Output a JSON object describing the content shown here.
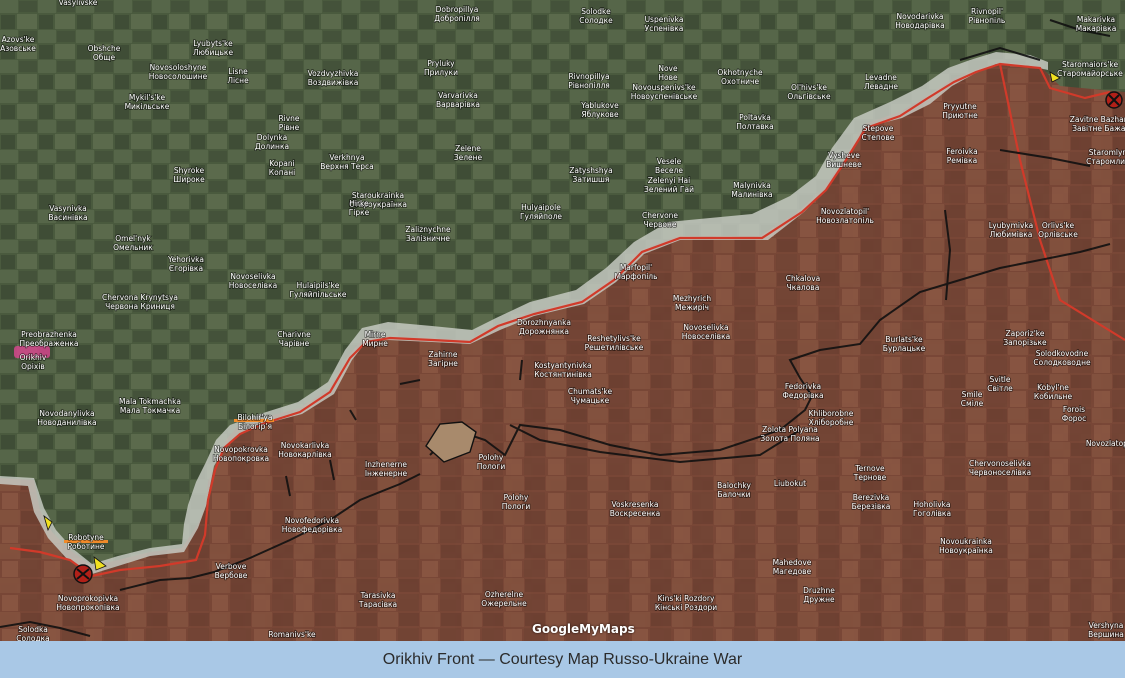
{
  "caption": "Orikhiv Front — Courtesy Map Russo-Ukraine War",
  "attribution": "GoogleMyMaps",
  "colors": {
    "ukrainian_controlled_terrain": "#4b5a3f",
    "russian_controlled_overlay": "#8a4a3a",
    "contested_gray_zone": "#c9cdc6",
    "front_line_red": "#d13a2a",
    "fortification_lines": "#111111",
    "caption_background": "#a9c8e6",
    "highlight_pink": "#d4468c",
    "marker_yellow": "#f0e020"
  },
  "icons": [
    "map-pin-icon",
    "explosion-marker-icon"
  ],
  "places": [
    [
      "Dobropillya",
      "Добропілля",
      457,
      12
    ],
    [
      "Solodke",
      "Солодке",
      596,
      14
    ],
    [
      "Uspenivka",
      "Успенівка",
      664,
      22
    ],
    [
      "Novodarivka",
      "Новодарівка",
      920,
      19
    ],
    [
      "Rivnopil'",
      "Рівнопіль",
      987,
      14
    ],
    [
      "Makarivka",
      "Макарівка",
      1096,
      22
    ],
    [
      "Vasylivske",
      "",
      78,
      5
    ],
    [
      "Obshche",
      "Обще",
      104,
      51
    ],
    [
      "Lyubyts'ke",
      "Любицьке",
      213,
      46
    ],
    [
      "Novosoloshyne",
      "Новосолошине",
      178,
      70
    ],
    [
      "Lisne",
      "Лісне",
      238,
      74
    ],
    [
      "Vozdvyzhivka",
      "Воздвижівка",
      333,
      76
    ],
    [
      "Pryluky",
      "Прилуки",
      441,
      66
    ],
    [
      "Nove",
      "Нове",
      668,
      71
    ],
    [
      "Okhotnyche",
      "Охотниче",
      740,
      75
    ],
    [
      "Rivnopillya",
      "Рівнопілля",
      589,
      79
    ],
    [
      "Novouspenivs'ke",
      "Новоуспенівське",
      664,
      90
    ],
    [
      "Ol'hivs'ke",
      "Ольгівське",
      809,
      90
    ],
    [
      "Levadne",
      "Левадне",
      881,
      80
    ],
    [
      "Staromaiors'ke",
      "Старомайорське",
      1090,
      67
    ],
    [
      "Mykil's'ke",
      "Микільське",
      147,
      100
    ],
    [
      "Varvarivka",
      "Варварівка",
      458,
      98
    ],
    [
      "Yablukove",
      "Яблукове",
      600,
      108
    ],
    [
      "Poltavka",
      "Полтавка",
      755,
      120
    ],
    [
      "Pryyutne",
      "Приютне",
      960,
      109
    ],
    [
      "Rivne",
      "Рівне",
      289,
      121
    ],
    [
      "Stepove",
      "Степове",
      878,
      131
    ],
    [
      "Dolynka",
      "Долинка",
      272,
      140
    ],
    [
      "Zelene",
      "Зелене",
      468,
      151
    ],
    [
      "Verkhnya",
      "Верхня Терса",
      347,
      160
    ],
    [
      "Kopani",
      "Копані",
      282,
      166
    ],
    [
      "Shyroke",
      "Широке",
      189,
      173
    ],
    [
      "Vysheve",
      "Вишневе",
      844,
      158
    ],
    [
      "Zatyshshya",
      "Затишшя",
      591,
      173
    ],
    [
      "Vesele",
      "Веселе",
      669,
      164
    ],
    [
      "Zelenyi Hai",
      "Зелений Гай",
      669,
      183
    ],
    [
      "Malynivka",
      "Малинівка",
      752,
      188
    ],
    [
      "Feroivka",
      "Ремівка",
      962,
      154
    ],
    [
      "Staroukrainka",
      "Староукраїнка",
      378,
      198
    ],
    [
      "Hirke",
      "Гірке",
      359,
      206
    ],
    [
      "Hulyaipole",
      "Гуляйполе",
      541,
      210
    ],
    [
      "Vasynivka",
      "Васинівка",
      68,
      211
    ],
    [
      "Novozlatopil'",
      "Новозлатопіль",
      845,
      214
    ],
    [
      "Chervone",
      "Червоне",
      660,
      218
    ],
    [
      "Lyubymivka",
      "Любимівка",
      1011,
      228
    ],
    [
      "Orlivs'ke",
      "Орлівське",
      1058,
      228
    ],
    [
      "Zaliznychne",
      "Залізничне",
      428,
      232
    ],
    [
      "Omel'nyk",
      "Омельник",
      133,
      241
    ],
    [
      "Yehorivka",
      "Єгорівка",
      186,
      262
    ],
    [
      "Marfopil'",
      "Марфопіль",
      636,
      270
    ],
    [
      "Novoselivka",
      "Новоселівка",
      253,
      279
    ],
    [
      "Chkalova",
      "Чкалова",
      803,
      281
    ],
    [
      "Hulaipils'ke",
      "Гуляйпільське",
      318,
      288
    ],
    [
      "Chervona Krynytsya",
      "Червона Криниця",
      140,
      300
    ],
    [
      "Mezhyrich",
      "Межиріч",
      692,
      301
    ],
    [
      "Dorozhnyanka",
      "Дорожнянка",
      544,
      325
    ],
    [
      "Novoselivka",
      "Новоселівка",
      706,
      330
    ],
    [
      "Preobrazhenka",
      "Преображенка",
      49,
      337
    ],
    [
      "Charivne",
      "Чарівне",
      294,
      337
    ],
    [
      "Reshetylivs'ke",
      "Решетилівське",
      614,
      341
    ],
    [
      "Mirne",
      "Мирне",
      375,
      337
    ],
    [
      "Burlats'ke",
      "Бурлацьке",
      904,
      342
    ],
    [
      "Zaporiz'ke",
      "Запорізьке",
      1025,
      336
    ],
    [
      "Solodkovodne",
      "Солодководне",
      1062,
      356
    ],
    [
      "Zahirne",
      "Загірне",
      443,
      357
    ],
    [
      "Kostyantynivka",
      "Костянтинівка",
      563,
      368
    ],
    [
      "Orikhiv",
      "Оріхів",
      33,
      360
    ],
    [
      "Fedorivka",
      "Федорівка",
      803,
      389
    ],
    [
      "Smile",
      "Сміле",
      972,
      397
    ],
    [
      "Svitle",
      "Світле",
      1000,
      382
    ],
    [
      "Kobyl'ne",
      "Кобильне",
      1053,
      390
    ],
    [
      "Chumats'ke",
      "Чумацьке",
      590,
      394
    ],
    [
      "Mala Tokmachka",
      "Мала Токмачка",
      150,
      404
    ],
    [
      "Novodanylivka",
      "Новоданилівка",
      67,
      416
    ],
    [
      "Bilohir'ya",
      "Білогір'я",
      255,
      420
    ],
    [
      "Khliborobne",
      "Хліборобне",
      831,
      416
    ],
    [
      "Zolota Polyana",
      "Золота Поляна",
      790,
      432
    ],
    [
      "Forois",
      "Форос",
      1074,
      412
    ],
    [
      "Novokarlivka",
      "Новокарлівка",
      305,
      448
    ],
    [
      "Novopokrovka",
      "Новопокровка",
      241,
      452
    ],
    [
      "Inzhenerne",
      "Інженерне",
      386,
      467
    ],
    [
      "Polohy",
      "Пологи",
      491,
      460
    ],
    [
      "Ternove",
      "Тернове",
      870,
      471
    ],
    [
      "Chervonoselivka",
      "Червоноселівка",
      1000,
      466
    ],
    [
      "Novozlatopil'",
      "",
      1110,
      446
    ],
    [
      "Balochky",
      "Балочки",
      734,
      488
    ],
    [
      "Liubokut",
      "",
      790,
      486
    ],
    [
      "Berezivka",
      "Березівка",
      871,
      500
    ],
    [
      "Hoholivka",
      "Гоголівка",
      932,
      507
    ],
    [
      "Polohy",
      "Пологи",
      516,
      500
    ],
    [
      "Voskresenka",
      "Воскресенка",
      635,
      507
    ],
    [
      "Novofedorivka",
      "Новофедорівка",
      312,
      523
    ],
    [
      "Robotyne",
      "Роботине",
      86,
      540
    ],
    [
      "Novoukrainka",
      "Новоукраїнка",
      966,
      544
    ],
    [
      "Verbove",
      "Вербове",
      231,
      569
    ],
    [
      "Mahedove",
      "Магедове",
      792,
      565
    ],
    [
      "Novoprokopivka",
      "Новопрокопівка",
      88,
      601
    ],
    [
      "Tarasivka",
      "Тарасівка",
      378,
      598
    ],
    [
      "Ozherelne",
      "Ожерельне",
      504,
      597
    ],
    [
      "Druzhne",
      "Дружне",
      819,
      593
    ],
    [
      "Kins'ki Rozdory",
      "Кінські Роздори",
      686,
      601
    ],
    [
      "Solodka",
      "Солодка",
      33,
      632
    ],
    [
      "Romanivs'ke",
      "",
      292,
      637
    ],
    [
      "Vershyna",
      "Вершина",
      1106,
      628
    ],
    [
      "Zavitne Bazhannya",
      "Завітне Бажання",
      1106,
      122
    ],
    [
      "Staromlyn",
      "Старомлин",
      1108,
      155
    ],
    [
      "Azovs'ke",
      "Азовське",
      18,
      42
    ]
  ]
}
